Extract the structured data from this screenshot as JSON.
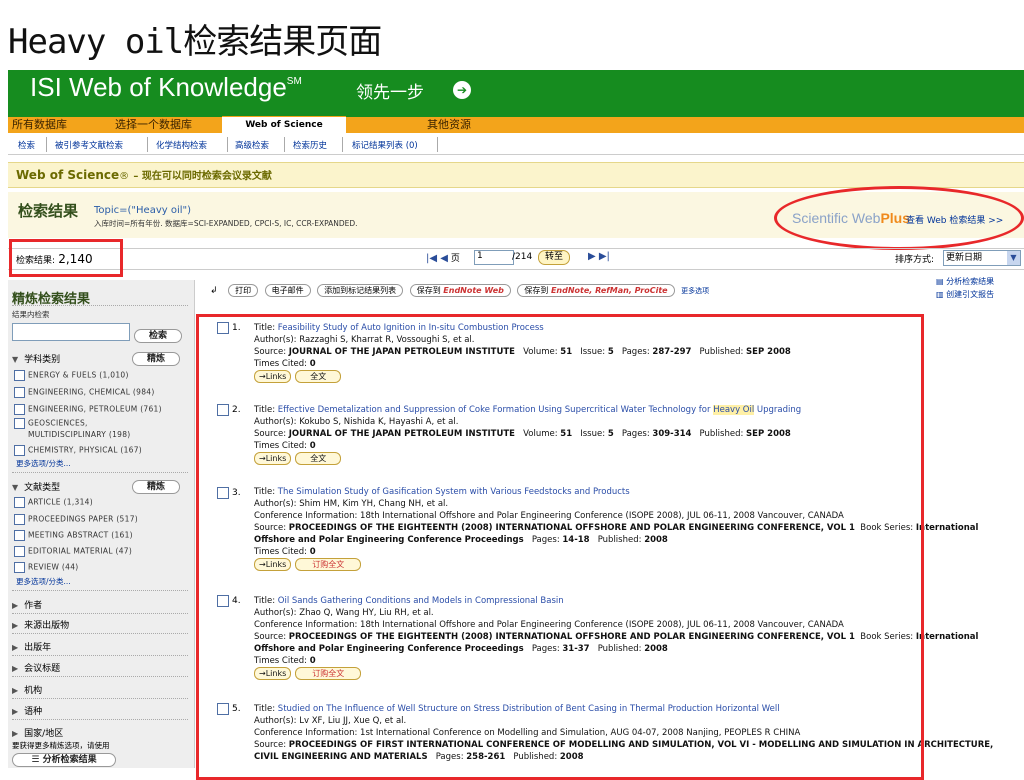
{
  "slide_title": "Heavy oil检索结果页面",
  "banner": {
    "logo": "ISI Web of Knowledge",
    "logo_sup": "SM",
    "slogan": "领先一步",
    "slogan_icon": "arrow-icon"
  },
  "db_tabs": {
    "all": "所有数据库",
    "choose": "选择一个数据库",
    "wos": "Web of Science",
    "other": "其他资源"
  },
  "subnav": [
    "检索",
    "被引参考文献检索",
    "化学结构检索",
    "高级检索",
    "检索历史",
    "标记结果列表 (0)"
  ],
  "wos_bar": {
    "title": "Web of Science",
    "reg": "®",
    "subtitle": "– 现在可以同时检索会议录文献"
  },
  "results_header": {
    "title": "检索结果",
    "topic": "Topic=(\"Heavy oil\")",
    "limits": "入库时间=所有年份. 数据库=SCI-EXPANDED, CPCI-S, IC, CCR-EXPANDED.",
    "webplus_a": "Scientific Web",
    "webplus_b": "Plus",
    "webplus_link": "查看 Web 检索结果 >>"
  },
  "count": {
    "label": "检索结果:",
    "value": "2,140"
  },
  "pager": {
    "page_label": "页",
    "page": "1",
    "total": "/214",
    "goto": "转至",
    "first_prev": "|◀ ◀",
    "next_last": "▶ ▶|"
  },
  "sort": {
    "label": "排序方式:",
    "value": "更新日期"
  },
  "sidebar": {
    "title": "精炼检索结果",
    "within": "结果内检索",
    "search_btn": "检索",
    "refine_btn": "精炼",
    "subject_label": "学科类别",
    "subjects": [
      "ENERGY & FUELS (1,010)",
      "ENGINEERING, CHEMICAL (984)",
      "ENGINEERING, PETROLEUM (761)",
      "GEOSCIENCES,",
      "MULTIDISCIPLINARY (198)",
      "CHEMISTRY, PHYSICAL (167)"
    ],
    "more": "更多选项/分类...",
    "doctype_label": "文献类型",
    "doctypes": [
      "ARTICLE (1,314)",
      "PROCEEDINGS PAPER (517)",
      "MEETING ABSTRACT (161)",
      "EDITORIAL MATERIAL (47)",
      "REVIEW (44)"
    ],
    "sections": [
      "作者",
      "来源出版物",
      "出版年",
      "会议标题",
      "机构",
      "语种",
      "国家/地区"
    ],
    "footnote": "要获得更多精炼选项，请使用",
    "analyze_btn": "分析检索结果"
  },
  "toolbar": {
    "print": "打印",
    "email": "电子邮件",
    "add_marked": "添加到标记结果列表",
    "save_to": "保存到",
    "endnote_web": "EndNote Web",
    "endnote": "EndNote, RefMan, ProCite",
    "more": "更多选项",
    "analyze": "分析检索结果",
    "citation_report": "创建引文报告"
  },
  "labels": {
    "title": "Title:",
    "authors": "Author(s):",
    "source": "Source:",
    "volume": "Volume:",
    "issue": "Issue:",
    "pages": "Pages:",
    "published": "Published:",
    "cited": "Times Cited:",
    "conference": "Conference Information:",
    "book_series": "Book Series:"
  },
  "records": [
    {
      "num": "1.",
      "title": "Feasibility Study of Auto Ignition in In-situ Combustion Process",
      "authors": "Razzaghi S, Kharrat R, Vossoughi S, et al.",
      "source": "JOURNAL OF THE JAPAN PETROLEUM INSTITUTE",
      "volume": "51",
      "issue": "5",
      "pages": "287-297",
      "published": "SEP 2008",
      "cited": "0",
      "links": "→Links",
      "full": "全文"
    },
    {
      "num": "2.",
      "title_a": "Effective Demetalization and Suppression of Coke Formation Using Supercritical Water Technology for ",
      "title_hl": "Heavy Oil",
      "title_b": " Upgrading",
      "authors": "Kokubo S, Nishida K, Hayashi A, et al.",
      "source": "JOURNAL OF THE JAPAN PETROLEUM INSTITUTE",
      "volume": "51",
      "issue": "5",
      "pages": "309-314",
      "published": "SEP 2008",
      "cited": "0",
      "links": "→Links",
      "full": "全文"
    },
    {
      "num": "3.",
      "title": "The Simulation Study of Gasification System with Various Feedstocks and Products",
      "authors": "Shim HM, Kim YH, Chang NH, et al.",
      "conference": "18th International Offshore and Polar Engineering Conference (ISOPE 2008), JUL 06-11, 2008 Vancouver, CANADA",
      "source": "PROCEEDINGS OF THE EIGHTEENTH (2008) INTERNATIONAL OFFSHORE AND POLAR ENGINEERING CONFERENCE, VOL 1",
      "series": "International Offshore and Polar Engineering Conference Proceedings",
      "pages": "14-18",
      "published": "2008",
      "cited": "0",
      "links": "→Links",
      "order": "订购全文"
    },
    {
      "num": "4.",
      "title": "Oil Sands Gathering Conditions and Models in Compressional Basin",
      "authors": "Zhao Q, Wang HY, Liu RH, et al.",
      "conference": "18th International Offshore and Polar Engineering Conference (ISOPE 2008), JUL 06-11, 2008 Vancouver, CANADA",
      "source": "PROCEEDINGS OF THE EIGHTEENTH (2008) INTERNATIONAL OFFSHORE AND POLAR ENGINEERING CONFERENCE, VOL 1",
      "series": "International Offshore and Polar Engineering Conference Proceedings",
      "pages": "31-37",
      "published": "2008",
      "cited": "0",
      "links": "→Links",
      "order": "订购全文"
    },
    {
      "num": "5.",
      "title": "Studied on The Influence of Well Structure on Stress Distribution of Bent Casing in Thermal Production Horizontal Well",
      "authors": "Lv XF, Liu JJ, Xue Q, et al.",
      "conference": "1st International Conference on Modelling and Simulation, AUG 04-07, 2008 Nanjing, PEOPLES R CHINA",
      "source": "PROCEEDINGS OF FIRST INTERNATIONAL CONFERENCE OF MODELLING AND SIMULATION, VOL VI - MODELLING AND SIMULATION IN ARCHITECTURE, CIVIL ENGINEERING AND MATERIALS",
      "pages": "258-261",
      "published": "2008"
    }
  ]
}
